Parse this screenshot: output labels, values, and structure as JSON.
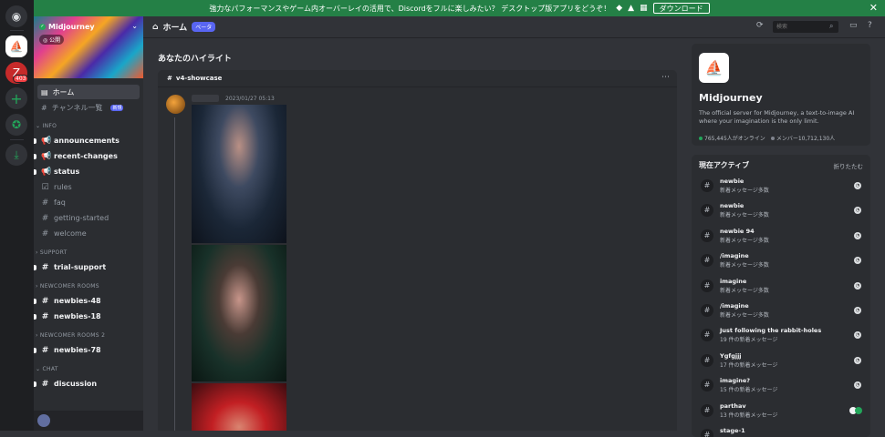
{
  "banner": {
    "text": "強力なパフォーマンスやゲーム内オーバーレイの活用で、Discordをフルに楽しみたい？ デスクトップ版アプリをどうぞ！",
    "download_label": "ダウンロード",
    "close": "✕"
  },
  "rail": {
    "badge": "403"
  },
  "server": {
    "name": "Midjourney",
    "public_label": "公開"
  },
  "nav": {
    "home": "ホーム",
    "channels": "チャンネル一覧",
    "new_badge": "新規"
  },
  "categories": {
    "info": "INFO",
    "support": "SUPPORT",
    "newcomer": "NEWCOMER ROOMS",
    "newcomer2": "NEWCOMER ROOMS 2",
    "chat": "CHAT"
  },
  "channels": {
    "announcements": "announcements",
    "recent_changes": "recent-changes",
    "status": "status",
    "rules": "rules",
    "faq": "faq",
    "getting_started": "getting-started",
    "welcome": "welcome",
    "trial_support": "trial-support",
    "newbies_48": "newbies-48",
    "newbies_18": "newbies-18",
    "newbies_78": "newbies-78",
    "discussion": "discussion"
  },
  "topbar": {
    "title": "ホーム",
    "beta": "ベータ",
    "search_placeholder": "検索"
  },
  "main": {
    "highlights_title": "あなたのハイライト",
    "card_channel": "v4-showcase",
    "timestamp": "2023/01/27 05:13"
  },
  "about": {
    "title": "Midjourney",
    "description": "The official server for Midjourney, a text-to-image AI where your imagination is the only limit.",
    "online": "765,445人がオンライン",
    "members": "メンバー10,712,130人"
  },
  "active_now": {
    "title": "現在アクティブ",
    "collapse": "折りたたむ",
    "items": [
      {
        "name": "newbie",
        "sub": "新着メッセージ多数"
      },
      {
        "name": "newbie",
        "sub": "新着メッセージ多数"
      },
      {
        "name": "newbie 94",
        "sub": "新着メッセージ多数"
      },
      {
        "name": "/imagine",
        "sub": "新着メッセージ多数"
      },
      {
        "name": "imagine",
        "sub": "新着メッセージ多数"
      },
      {
        "name": "/imagine",
        "sub": "新着メッセージ多数"
      },
      {
        "name": "Just following the rabbit-holes",
        "sub": "19 件の新着メッセージ"
      },
      {
        "name": "Ygfgjjj",
        "sub": "17 件の新着メッセージ"
      },
      {
        "name": "imagine?",
        "sub": "15 件の新着メッセージ"
      },
      {
        "name": "parthav",
        "sub": "13 件の新着メッセージ"
      },
      {
        "name": "stage-1",
        "sub": ""
      }
    ]
  }
}
